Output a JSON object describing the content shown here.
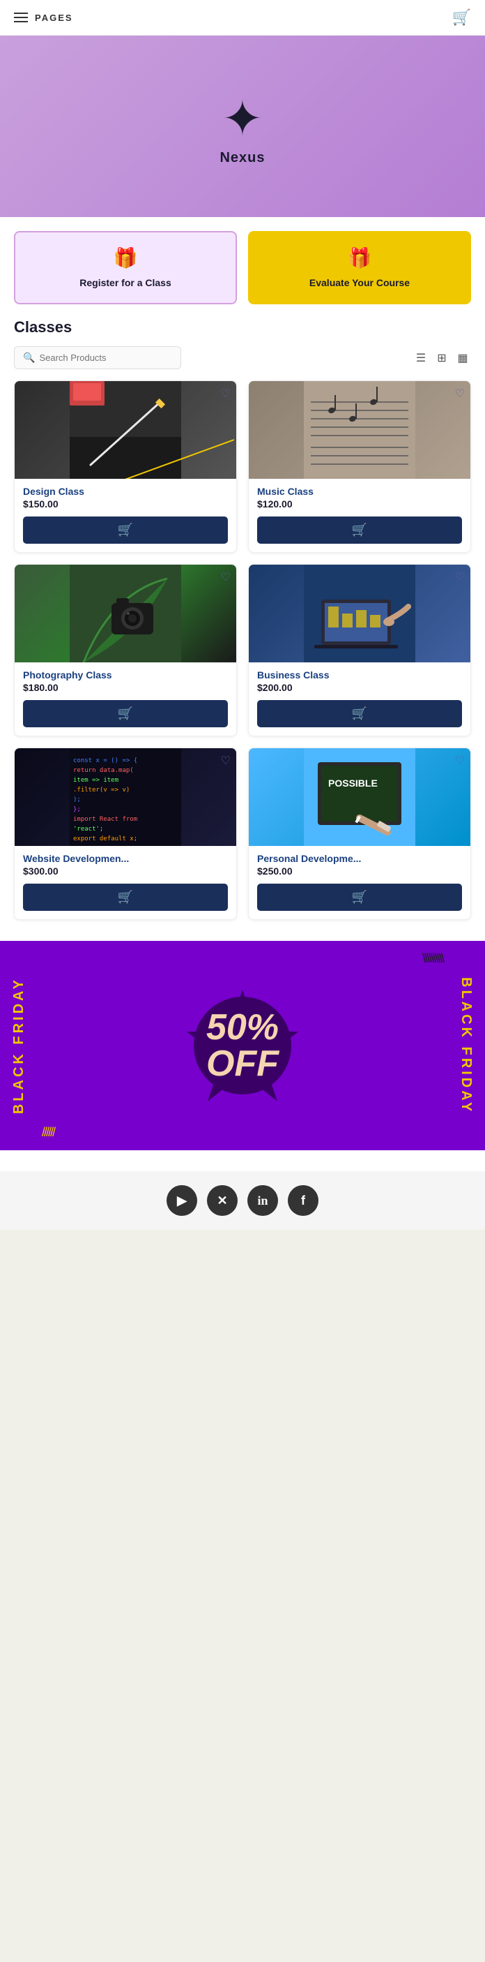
{
  "header": {
    "title": "PAGES",
    "cart_icon": "🛒"
  },
  "hero": {
    "star": "✦",
    "brand_name": "Nexus"
  },
  "actions": [
    {
      "id": "register",
      "icon": "🎁",
      "label": "Register for a Class",
      "active": false
    },
    {
      "id": "evaluate",
      "icon": "🎁",
      "label": "Evaluate Your Course",
      "active": true
    }
  ],
  "classes_section": {
    "title": "Classes",
    "search_placeholder": "Search Products"
  },
  "products": [
    {
      "id": "design",
      "name": "Design Class",
      "price": "$150.00",
      "img_class": "img-design"
    },
    {
      "id": "music",
      "name": "Music Class",
      "price": "$120.00",
      "img_class": "img-music"
    },
    {
      "id": "photography",
      "name": "Photography Class",
      "price": "$180.00",
      "img_class": "img-photography"
    },
    {
      "id": "business",
      "name": "Business Class",
      "price": "$200.00",
      "img_class": "img-business"
    },
    {
      "id": "webdev",
      "name": "Website Developmen...",
      "price": "$300.00",
      "img_class": "img-webdev"
    },
    {
      "id": "personal",
      "name": "Personal Developme...",
      "price": "$250.00",
      "img_class": "img-personal"
    }
  ],
  "black_friday": {
    "side_left": "BLACK FRIDAY",
    "side_right": "BLACK FRIDAY",
    "main_text": "50% OFF",
    "slashes_top": "\\\\\\\\\\\\\\",
    "slashes_bottom": "///////"
  },
  "footer": {
    "social_icons": [
      {
        "name": "youtube",
        "symbol": "▶"
      },
      {
        "name": "x-twitter",
        "symbol": "✕"
      },
      {
        "name": "linkedin",
        "symbol": "in"
      },
      {
        "name": "facebook",
        "symbol": "f"
      }
    ]
  }
}
